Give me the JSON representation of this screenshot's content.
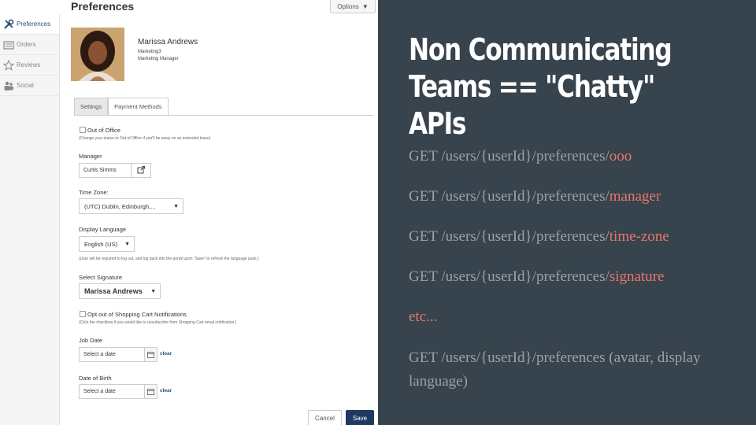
{
  "sidebar": {
    "items": [
      {
        "label": "Preferences",
        "icon": "wrench-screwdriver-icon"
      },
      {
        "label": "Orders",
        "icon": "orders-icon"
      },
      {
        "label": "Reviews",
        "icon": "star-icon"
      },
      {
        "label": "Social",
        "icon": "people-icon"
      }
    ]
  },
  "header": {
    "title": "Preferences",
    "options_label": "Options"
  },
  "profile": {
    "name": "Marissa Andrews",
    "department": "Marketing3",
    "job_title": "Marketing Manager"
  },
  "tabs": [
    {
      "label": "Settings"
    },
    {
      "label": "Payment Methods"
    }
  ],
  "form": {
    "ooo_label": "Out of Office",
    "ooo_note": "(Change your status to Out of Office if you'll be away on an extended leave)",
    "manager_label": "Manager",
    "manager_value": "Curtis Simms",
    "timezone_label": "Time Zone:",
    "timezone_value": "(UTC) Dublin, Edinburgh,...",
    "language_label": "Display Language",
    "language_value": "English (US)",
    "language_note": "(User will be required to log out, and log back into the portal upon \"Save\" to refresh the language pack.)",
    "signature_label": "Select Signature",
    "signature_value": "Marissa Andrews",
    "cart_label": "Opt out of Shopping Cart Notifications",
    "cart_note": "(Click the checkbox if you would like to unsubscribe from Shopping Cart email notification.)",
    "job_date_label": "Job Date",
    "job_date_placeholder": "Select a date",
    "dob_label": "Date of Birth",
    "dob_placeholder": "Select a date",
    "clear_label": "clear",
    "cancel_label": "Cancel",
    "save_label": "Save"
  },
  "slide": {
    "title_line1": "Non Communicating",
    "title_line2": "Teams == \"Chatty\" APIs",
    "api_base": "GET /users/{userId}/preferences/",
    "apis": [
      {
        "suffix": "ooo"
      },
      {
        "suffix": "manager"
      },
      {
        "suffix": "time-zone"
      },
      {
        "suffix": "signature"
      }
    ],
    "etc": "etc...",
    "last_line": "GET /users/{userId}/preferences (avatar, display language)"
  },
  "colors": {
    "slide_bg": "#37434d",
    "title": "#ffffff",
    "api_text": "#9aa2a8",
    "accent": "#e8776a",
    "save_button": "#1f3a5f"
  }
}
